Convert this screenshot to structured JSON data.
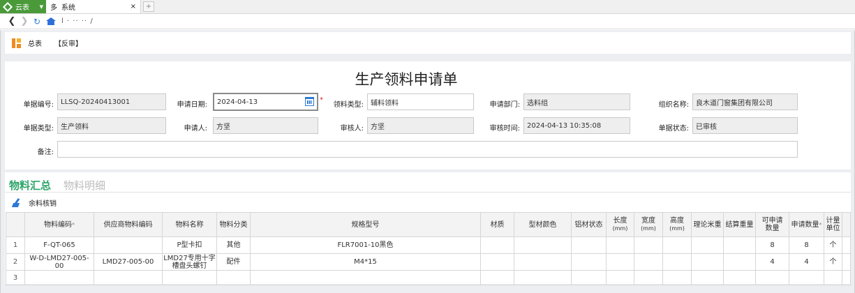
{
  "tabbar": {
    "app_label": "云表",
    "page_tab_prefix": "多",
    "page_tab_title": "系统",
    "close_glyph": "×",
    "new_tab_glyph": "+"
  },
  "navbar": {
    "url_text": "l  ·  ··  ··  /"
  },
  "toolbar": {
    "summary_label": "总表",
    "reverse_audit_label": "【反审】"
  },
  "form": {
    "title": "生产领料申请单",
    "doc_no_label": "单据编号:",
    "doc_no": "LLSQ-20240413001",
    "apply_date_label": "申请日期:",
    "apply_date": "2024-04-13",
    "required_mark": "*",
    "material_type_label": "领料类型:",
    "material_type": "辅料领料",
    "apply_dept_label": "申请部门:",
    "apply_dept": "选料组",
    "org_label": "组织名称:",
    "org": "良木道门窗集团有限公司",
    "doc_type_label": "单据类型:",
    "doc_type": "生产领料",
    "applicant_label": "申请人:",
    "applicant": "方坚",
    "auditor_label": "审核人:",
    "auditor": "方坚",
    "audit_time_label": "审核时间:",
    "audit_time": "2024-04-13 10:35:08",
    "doc_status_label": "单据状态:",
    "doc_status": "已审核",
    "remark_label": "备注:",
    "remark": ""
  },
  "tabs": {
    "summary": "物料汇总",
    "detail": "物料明细"
  },
  "actions": {
    "clear_remaining": "余料核销"
  },
  "table": {
    "headers": {
      "code": "物料编码",
      "code_star": "*",
      "supplier_code": "供应商物料编码",
      "name": "物料名称",
      "category": "物料分类",
      "spec": "规格型号",
      "material": "材质",
      "color": "型材颜色",
      "al_state": "铝材状态",
      "length": "长度",
      "width": "宽度",
      "height": "高度",
      "unit_mm": "(mm)",
      "theory_weight": "理论米重",
      "settle_weight": "结算重量",
      "avail_qty_1": "可申请",
      "avail_qty_2": "数量",
      "apply_qty": "申请数量",
      "apply_qty_star": "*",
      "unit_1": "计量",
      "unit_2": "单位"
    },
    "rows": [
      {
        "no": "1",
        "code": "F-QT-065",
        "supplier_code": "",
        "name_1": "P型卡扣",
        "name_2": "",
        "category": "其他",
        "spec": "FLR7001-10黑色",
        "avail_qty": "8",
        "apply_qty": "8",
        "unit": "个"
      },
      {
        "no": "2",
        "code": "W-D-LMD27-005-00",
        "supplier_code": "LMD27-005-00",
        "name_1": "LMD27专用十字",
        "name_2": "槽盘头螺钉",
        "category": "配件",
        "spec": "M4*15",
        "avail_qty": "4",
        "apply_qty": "4",
        "unit": "个"
      },
      {
        "no": "3"
      }
    ]
  }
}
